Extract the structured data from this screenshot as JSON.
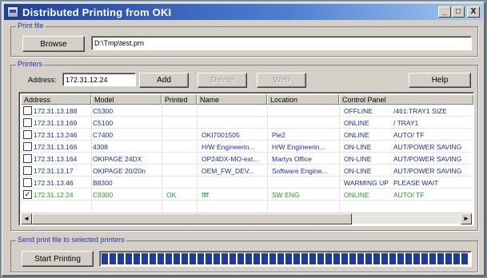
{
  "window": {
    "title": "Distributed Printing from OKI",
    "minimize_label": "_",
    "maximize_label": "□",
    "close_label": "X"
  },
  "print_file": {
    "legend": "Print file",
    "browse_label": "Browse",
    "path_value": "D:\\Tmp\\test.prn"
  },
  "printers": {
    "legend": "Printers",
    "address_label": "Address:",
    "address_value": "172.31.12.24",
    "add_label": "Add",
    "delete_label": "Delete",
    "web_label": "Web",
    "help_label": "Help",
    "columns": [
      "Address",
      "Model",
      "Printed",
      "Name",
      "Location",
      "Control Panel"
    ],
    "rows": [
      {
        "checked": false,
        "address": "172.31.13.188",
        "model": "C5300",
        "printed": "",
        "name": "",
        "location": "",
        "panel": "OFFLINE",
        "panel2": "/461:TRAY1 SIZE"
      },
      {
        "checked": false,
        "address": "172.31.13.169",
        "model": "C5100",
        "printed": "",
        "name": "",
        "location": "",
        "panel": "ONLINE",
        "panel2": "/       TRAY1"
      },
      {
        "checked": false,
        "address": "172.31.13.246",
        "model": "C7400",
        "printed": "",
        "name": "OKI7001505",
        "location": "Pie2",
        "panel": "ONLINE",
        "panel2": "AUTO/        TF"
      },
      {
        "checked": false,
        "address": "172.31.13.166",
        "model": "4308",
        "printed": "",
        "name": "H/W Engineerin...",
        "location": "H/W Engineerin...",
        "panel": "ON-LINE",
        "panel2": "AUT/POWER SAVING"
      },
      {
        "checked": false,
        "address": "172.31.13.164",
        "model": "OKIPAGE 24DX",
        "printed": "",
        "name": "OP24DX-MO-ext...",
        "location": "Martys Office",
        "panel": "ON-LINE",
        "panel2": "AUT/POWER SAVING"
      },
      {
        "checked": false,
        "address": "172.31.13.17",
        "model": "OKIPAGE 20/20n",
        "printed": "",
        "name": "OEM_FW_DEV...",
        "location": "Software Engine...",
        "panel": "ON-LINE",
        "panel2": "AUT/POWER SAVING"
      },
      {
        "checked": false,
        "address": "172.31.13.46",
        "model": "B8300",
        "printed": "",
        "name": "",
        "location": "",
        "panel": "WARMING UP",
        "panel2": "PLEASE WAIT"
      },
      {
        "checked": true,
        "address": "172.31.12.24",
        "model": "C9300",
        "printed": "OK",
        "name": "ffff",
        "location": "SW ENG",
        "panel": "ONLINE",
        "panel2": "AUTO/        TF"
      }
    ],
    "scroll_left_label": "◄",
    "scroll_right_label": "►"
  },
  "send": {
    "legend": "Send print file to selected printers",
    "start_label": "Start Printing",
    "progress_fraction": 1.0
  },
  "colors": {
    "accent": "#1f3aa5",
    "selected_row_text": "#1aa31a",
    "row_text": "#1b2ea8"
  }
}
